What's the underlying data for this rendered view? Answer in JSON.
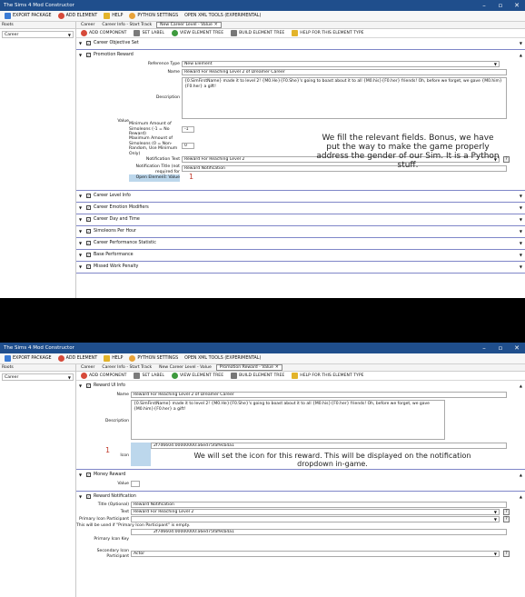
{
  "app_title": "The Sims 4 Mod Constructor",
  "toolbar": {
    "export": "EXPORT PACKAGE",
    "add": "ADD ELEMENT",
    "help": "HELP",
    "python": "PYTHON SETTINGS",
    "xml": "OPEN XML TOOLS (EXPERIMENTAL)"
  },
  "sidebar": {
    "tab": "Roots",
    "item": "Career"
  },
  "win1": {
    "crumbs": [
      "Career",
      "Career Info - Start Track",
      "New Career Level - Value"
    ],
    "crumb_close": "✕",
    "actions": [
      "ADD COMPONENT",
      "SET LABEL",
      "VIEW ELEMENT TREE",
      "BUILD ELEMENT TREE",
      "HELP FOR THIS ELEMENT TYPE"
    ],
    "sections_top": [
      "Career Objective Set",
      "Promotion Reward"
    ],
    "ref_type_label": "Reference Type",
    "ref_type_value": "New Element",
    "name_label": "Name",
    "name_value": "Reward For Reaching Level 2 of Dreamer Career",
    "desc_label": "Description",
    "desc_value": "{0.SimFirstName} made it to level 2! {M0.He}{F0.She}'s going to boast about it to all {M0.his}{F0.her} friends! Oh, before we forget, we gave {M0.him}{F0.her} a gift!",
    "value_label": "Value",
    "min_label": "Minimum Amount of Simoleons (-1 = No Reward)",
    "min_value": "-1",
    "max_label": "Maximum Amount of Simoleons (0 = Non-Random, Use Minimum Only)",
    "max_value": "0",
    "notif_text_label": "Notification Text",
    "notif_text_value": "Reward For Reaching Level 2",
    "notif_title_label": "Notification Title (not required for notification)",
    "notif_title_value": "Reward Notification",
    "open_element": "Open Element: Value",
    "mark": "1",
    "overlay": "We fill the relevant fields. Bonus, we have put the way to make the game properly address the gender of our Sim. It is a Python stuff.",
    "sections_bottom": [
      "Career Level Info",
      "Career Emotion Modifiers",
      "Career Day and Time",
      "Simoleons Per Hour",
      "Career Performance Statistic",
      "Base Performance",
      "Missed Work Penalty"
    ]
  },
  "win2": {
    "crumbs": [
      "Career",
      "Career Info - Start Track",
      "New Career Level - Value",
      "Promotion Reward - Value"
    ],
    "crumb_close": "✕",
    "actions": [
      "ADD COMPONENT",
      "SET LABEL",
      "VIEW ELEMENT TREE",
      "BUILD ELEMENT TREE",
      "HELP FOR THIS ELEMENT TYPE"
    ],
    "reward_ui": "Reward UI Info",
    "name_label": "Name",
    "name_value": "Reward For Reaching Level 2 of Dreamer Career",
    "desc_label": "Description",
    "desc_value": "{0.SimFirstName} made it to level 2! {M0.He}{F0.She}'s going to boast about it to all {M0.his}{F0.her} friends! Oh, before we forget, we gave {M0.him}{F0.her} a gift!",
    "icon_label": "Icon",
    "icon_value": "2f7d6604:00000000:a6ed75faf9cb4a1",
    "mark": "1",
    "overlay": "We will set the icon for this reward. This will be displayed on the notification dropdown in-game.",
    "money_reward": "Money Reward",
    "value_label": "Value",
    "reward_notif": "Reward Notification",
    "title_label": "Title (Optional)",
    "title_value": "Reward Notification",
    "text_label": "Text",
    "text_value": "Reward For Reaching Level 2",
    "primary_part_label": "Primary Icon Participant",
    "primary_part_note": "This will be used if \"Primary Icon Participant\" is empty.",
    "primary_key_label": "Primary Icon Key",
    "primary_key_value": "2f7d6604:00000000:a6ed75faf9cb4a1",
    "secondary_label": "Secondary Icon Participant",
    "secondary_value": "Actor"
  },
  "colors": {
    "titlebar": "#1f4e8c",
    "section_border": "#7f86c8",
    "highlight": "#bcd7ec",
    "mark": "#c0392b"
  }
}
